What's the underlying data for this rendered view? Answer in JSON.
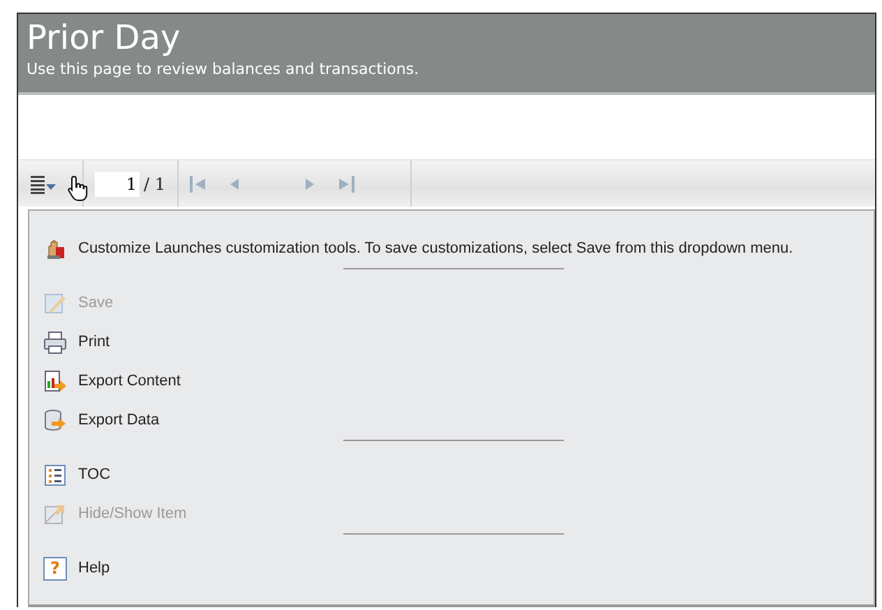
{
  "header": {
    "title": "Prior Day",
    "subtitle": "Use this page to review balances and transactions."
  },
  "toolbar": {
    "page_value": "1",
    "page_total": "/ 1"
  },
  "menu": [
    {
      "kind": "item",
      "label": "Customize Launches customization tools. To save customizations, select Save from this dropdown menu.",
      "disabled": false
    },
    {
      "kind": "separator"
    },
    {
      "kind": "item",
      "label": "Save",
      "disabled": true
    },
    {
      "kind": "item",
      "label": "Print",
      "disabled": false
    },
    {
      "kind": "item",
      "label": "Export Content",
      "disabled": false
    },
    {
      "kind": "item",
      "label": "Export Data",
      "disabled": false
    },
    {
      "kind": "separator"
    },
    {
      "kind": "item",
      "label": "TOC",
      "disabled": false
    },
    {
      "kind": "item",
      "label": "Hide/Show Item",
      "disabled": true
    },
    {
      "kind": "separator"
    },
    {
      "kind": "item",
      "icon_glyph": "?",
      "label": "Help",
      "disabled": false
    }
  ]
}
